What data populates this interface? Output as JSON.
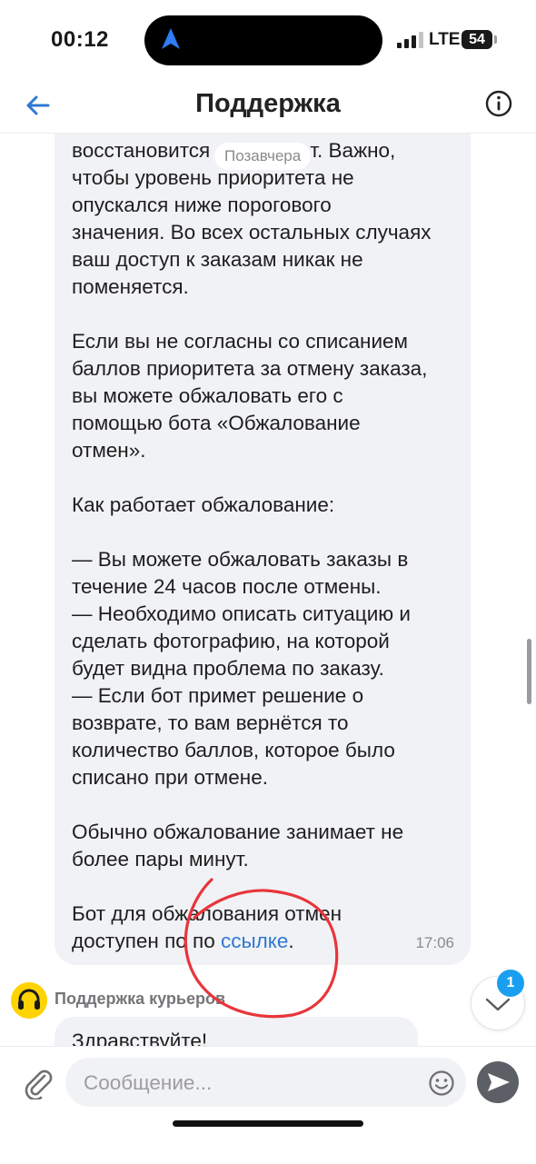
{
  "status_bar": {
    "time": "00:12",
    "network": "LTE",
    "battery": "54"
  },
  "header": {
    "title": "Поддержка"
  },
  "chat": {
    "date_divider": "Позавчера",
    "message": {
      "paragraphs": [
        [
          "восстановится",
          "т. Важно,",
          "чтобы уровень приоритета не",
          "опускался ниже порогового",
          "значения. Во всех остальных случаях",
          "ваш доступ к заказам никак не",
          "поменяется."
        ],
        [
          "Если вы не согласны со списанием",
          "баллов приоритета за отмену заказа,",
          "вы можете обжаловать его с",
          "помощью бота «Обжалование",
          "отмен»."
        ],
        [
          "Как работает обжалование:"
        ],
        [
          "— Вы можете обжаловать заказы в",
          "течение 24 часов после отмены.",
          "— Необходимо описать ситуацию и",
          "сделать фотографию, на которой",
          "будет видна проблема по заказу.",
          "— Если бот примет решение о",
          "возврате, то вам вернётся то",
          "количество баллов, которое было",
          "списано при отмене."
        ],
        [
          "Обычно обжалование занимает не",
          "более пары минут."
        ]
      ],
      "last_line_1": "Бот для обжалования отмен",
      "last_line_2_prefix": "доступен по по ",
      "link_text": "ссылке",
      "last_line_2_suffix": ".",
      "time": "17:06"
    },
    "next_sender": "Поддержка курьеров",
    "next_message_preview": "Здравствуйте!",
    "unread_count": "1"
  },
  "input": {
    "placeholder": "Сообщение..."
  },
  "icons": {
    "back": "arrow-left-icon",
    "info": "info-icon",
    "attach": "paperclip-icon",
    "emoji": "smiley-icon",
    "send": "send-icon",
    "scroll_down": "chevron-down-icon"
  },
  "colors": {
    "accent": "#2e78d2",
    "unread_badge": "#1a9ff0",
    "annotation": "#e8353b",
    "avatar": "#ffd300"
  }
}
